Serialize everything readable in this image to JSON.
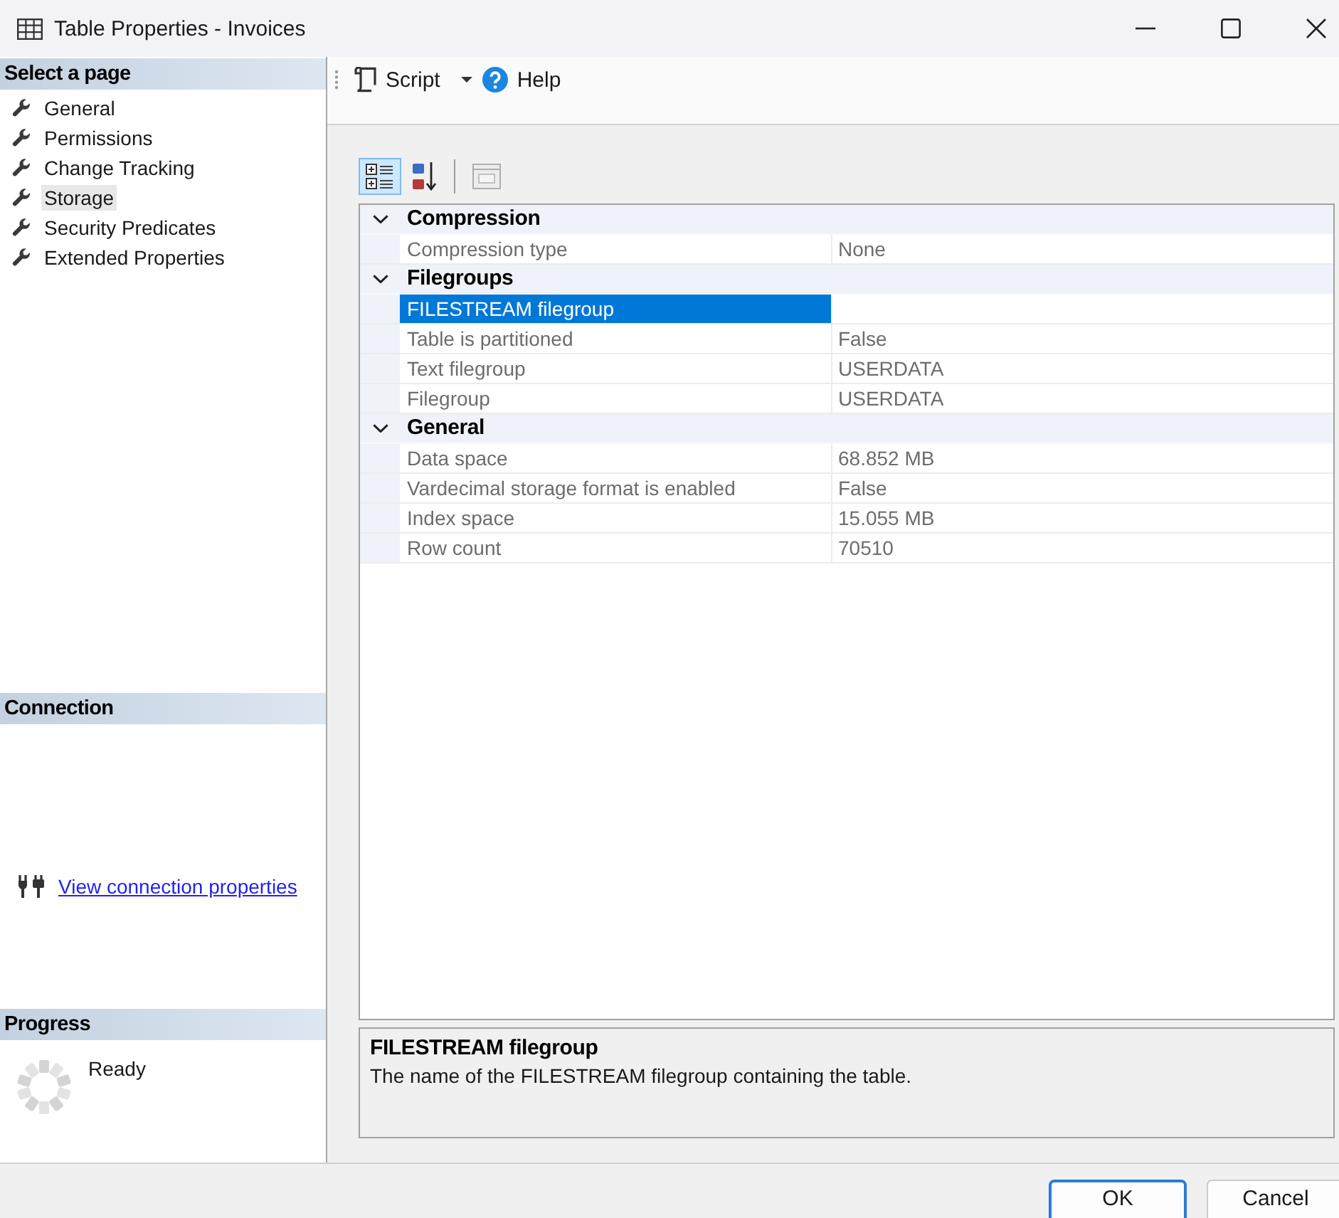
{
  "window": {
    "title": "Table Properties - Invoices"
  },
  "sidebar": {
    "header": "Select a page",
    "items": [
      {
        "label": "General",
        "selected": false
      },
      {
        "label": "Permissions",
        "selected": false
      },
      {
        "label": "Change Tracking",
        "selected": false
      },
      {
        "label": "Storage",
        "selected": true
      },
      {
        "label": "Security Predicates",
        "selected": false
      },
      {
        "label": "Extended Properties",
        "selected": false
      }
    ]
  },
  "connection": {
    "header": "Connection",
    "link": "View connection properties"
  },
  "progress": {
    "header": "Progress",
    "status": "Ready"
  },
  "toolbar": [
    {
      "kind": "script",
      "label": "Script"
    },
    {
      "kind": "help",
      "label": "Help"
    }
  ],
  "property_grid": {
    "view_buttons": [
      {
        "kind": "categorized",
        "selected": true,
        "disabled": false
      },
      {
        "kind": "alphabetical",
        "selected": false,
        "disabled": false
      },
      {
        "kind": "property_pages",
        "selected": false,
        "disabled": true
      }
    ],
    "categories": [
      {
        "name": "Compression",
        "expanded": true,
        "properties": [
          {
            "name": "Compression type",
            "value": "None",
            "selected": false
          }
        ]
      },
      {
        "name": "Filegroups",
        "expanded": true,
        "properties": [
          {
            "name": "FILESTREAM filegroup",
            "selected": true
          },
          {
            "name": "Table is partitioned",
            "value": "False",
            "selected": false
          },
          {
            "name": "Text filegroup",
            "value": "USERDATA",
            "selected": false
          },
          {
            "name": "Filegroup",
            "value": "USERDATA",
            "selected": false
          }
        ]
      },
      {
        "name": "General",
        "expanded": true,
        "properties": [
          {
            "name": "Data space",
            "value": "68.852 MB",
            "selected": false
          },
          {
            "name": "Vardecimal storage format is enabled",
            "value": "False",
            "selected": false
          },
          {
            "name": "Index space",
            "value": "15.055 MB",
            "selected": false
          },
          {
            "name": "Row count",
            "value": "70510",
            "selected": false
          }
        ]
      }
    ]
  },
  "description": {
    "title": "FILESTREAM filegroup",
    "text": "The name of the FILESTREAM filegroup containing the table."
  },
  "buttons": [
    {
      "label": "OK",
      "default": true
    },
    {
      "label": "Cancel",
      "default": false
    }
  ]
}
